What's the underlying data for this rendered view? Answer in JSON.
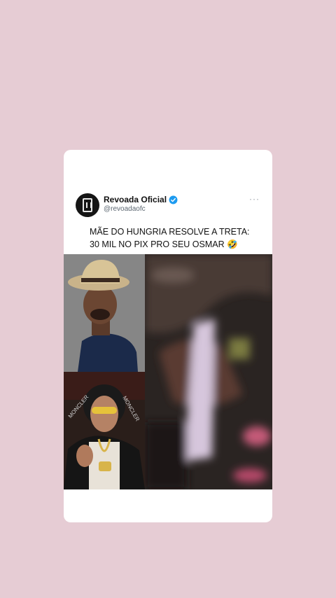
{
  "tweet": {
    "display_name": "Revoada Oficial",
    "handle": "@revoadaofc",
    "more": "···",
    "text": "MÃE DO HUNGRIA RESOLVE A TRETA:\n30 MIL NO PIX PRO SEU OSMAR 🤣",
    "verified": true
  },
  "colors": {
    "background": "#e6ccd4",
    "card": "#ffffff",
    "verified": "#1d9bf0"
  }
}
